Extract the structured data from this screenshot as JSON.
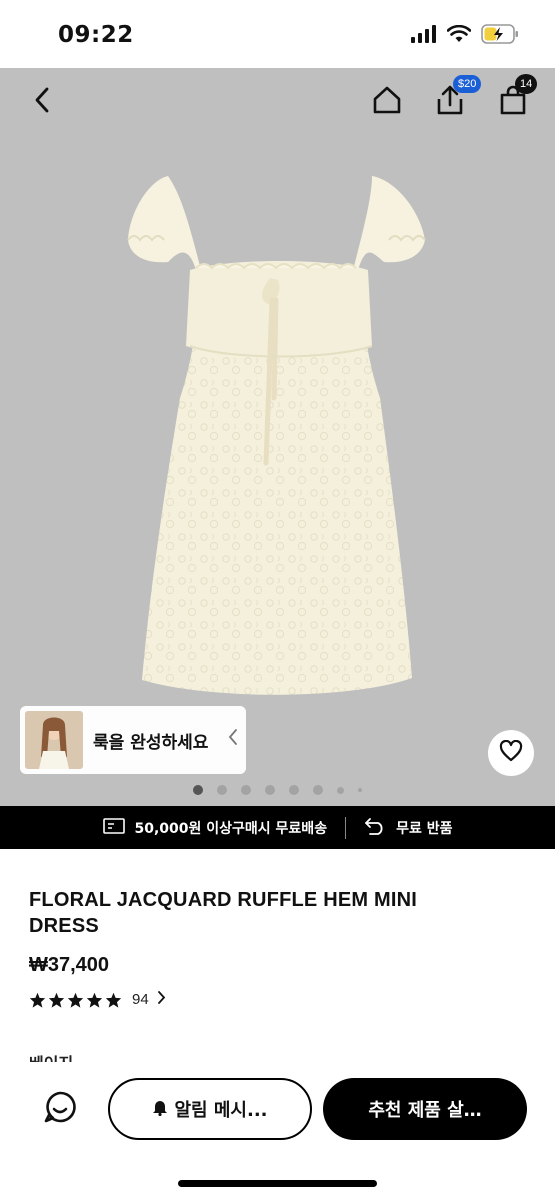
{
  "status_bar": {
    "time": "09:22"
  },
  "header": {
    "share_badge": "$20",
    "cart_badge": "14"
  },
  "gallery": {
    "look_card_label": "룩을 완성하세요",
    "image_count": 8,
    "active_index": 0
  },
  "promo": {
    "shipping": "50,000원 이상구매시 무료배송",
    "returns": "무료 반품"
  },
  "product": {
    "title": "FLORAL JACQUARD RUFFLE HEM MINI DRESS",
    "price": "₩37,400",
    "rating_stars": 5,
    "review_count": "94",
    "color_label": "베이지"
  },
  "bottom_bar": {
    "notify_label": "알림 메시...",
    "recommend_label": "추천 제품 살…"
  },
  "colors": {
    "accent_blue": "#1a5fd6",
    "gallery_bg": "#bfbfbf",
    "dress": "#f4f0dc"
  }
}
